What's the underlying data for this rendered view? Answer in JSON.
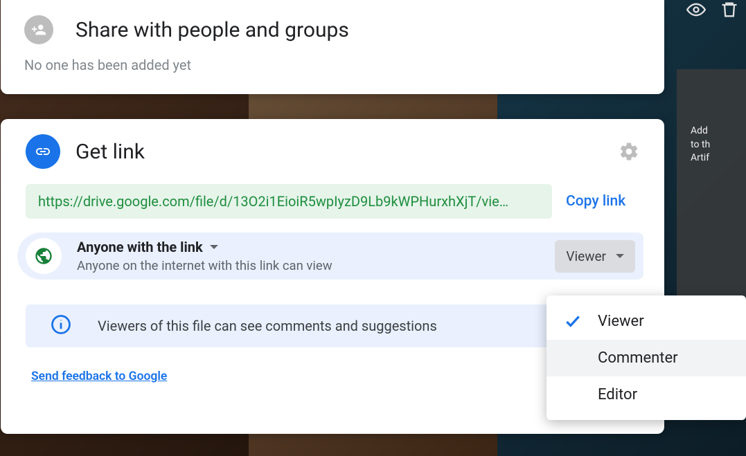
{
  "share_card": {
    "title": "Share with people and groups",
    "subtext": "No one has been added yet"
  },
  "getlink_card": {
    "title": "Get link",
    "url": "https://drive.google.com/file/d/13O2i1EioiR5wpIyzD9Lb9kWPHurxhXjT/vie…",
    "copy_label": "Copy link",
    "scope_title": "Anyone with the link",
    "scope_desc": "Anyone on the internet with this link can view",
    "role_button_label": "Viewer",
    "info_text": "Viewers of this file can see comments and suggestions",
    "feedback_label": "Send feedback to Google"
  },
  "role_menu": {
    "selected": "Viewer",
    "hovered": "Commenter",
    "options": {
      "viewer": "Viewer",
      "commenter": "Commenter",
      "editor": "Editor"
    }
  }
}
